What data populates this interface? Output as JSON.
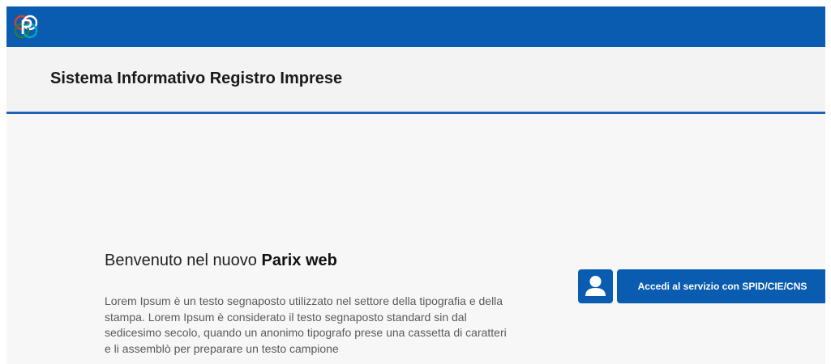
{
  "header": {
    "logo_icon": "parix-logo-icon",
    "site_title": "Sistema Informativo Registro Imprese"
  },
  "colors": {
    "primary_blue": "#0a5cb0",
    "header_border": "#1e63b5",
    "background": "#f7f7f7"
  },
  "main": {
    "welcome_prefix": "Benvenuto nel nuovo",
    "welcome_brand": "Parix web",
    "description": "Lorem Ipsum è un testo segnaposto utilizzato nel settore della tipografia e della stampa. Lorem Ipsum è considerato il testo segnaposto standard sin dal sedicesimo secolo, quando un anonimo tipografo prese una cassetta di caratteri e li assemblò per preparare un testo campione"
  },
  "login": {
    "icon": "user-icon",
    "button_label": "Accedi al servizio con SPID/CIE/CNS"
  }
}
